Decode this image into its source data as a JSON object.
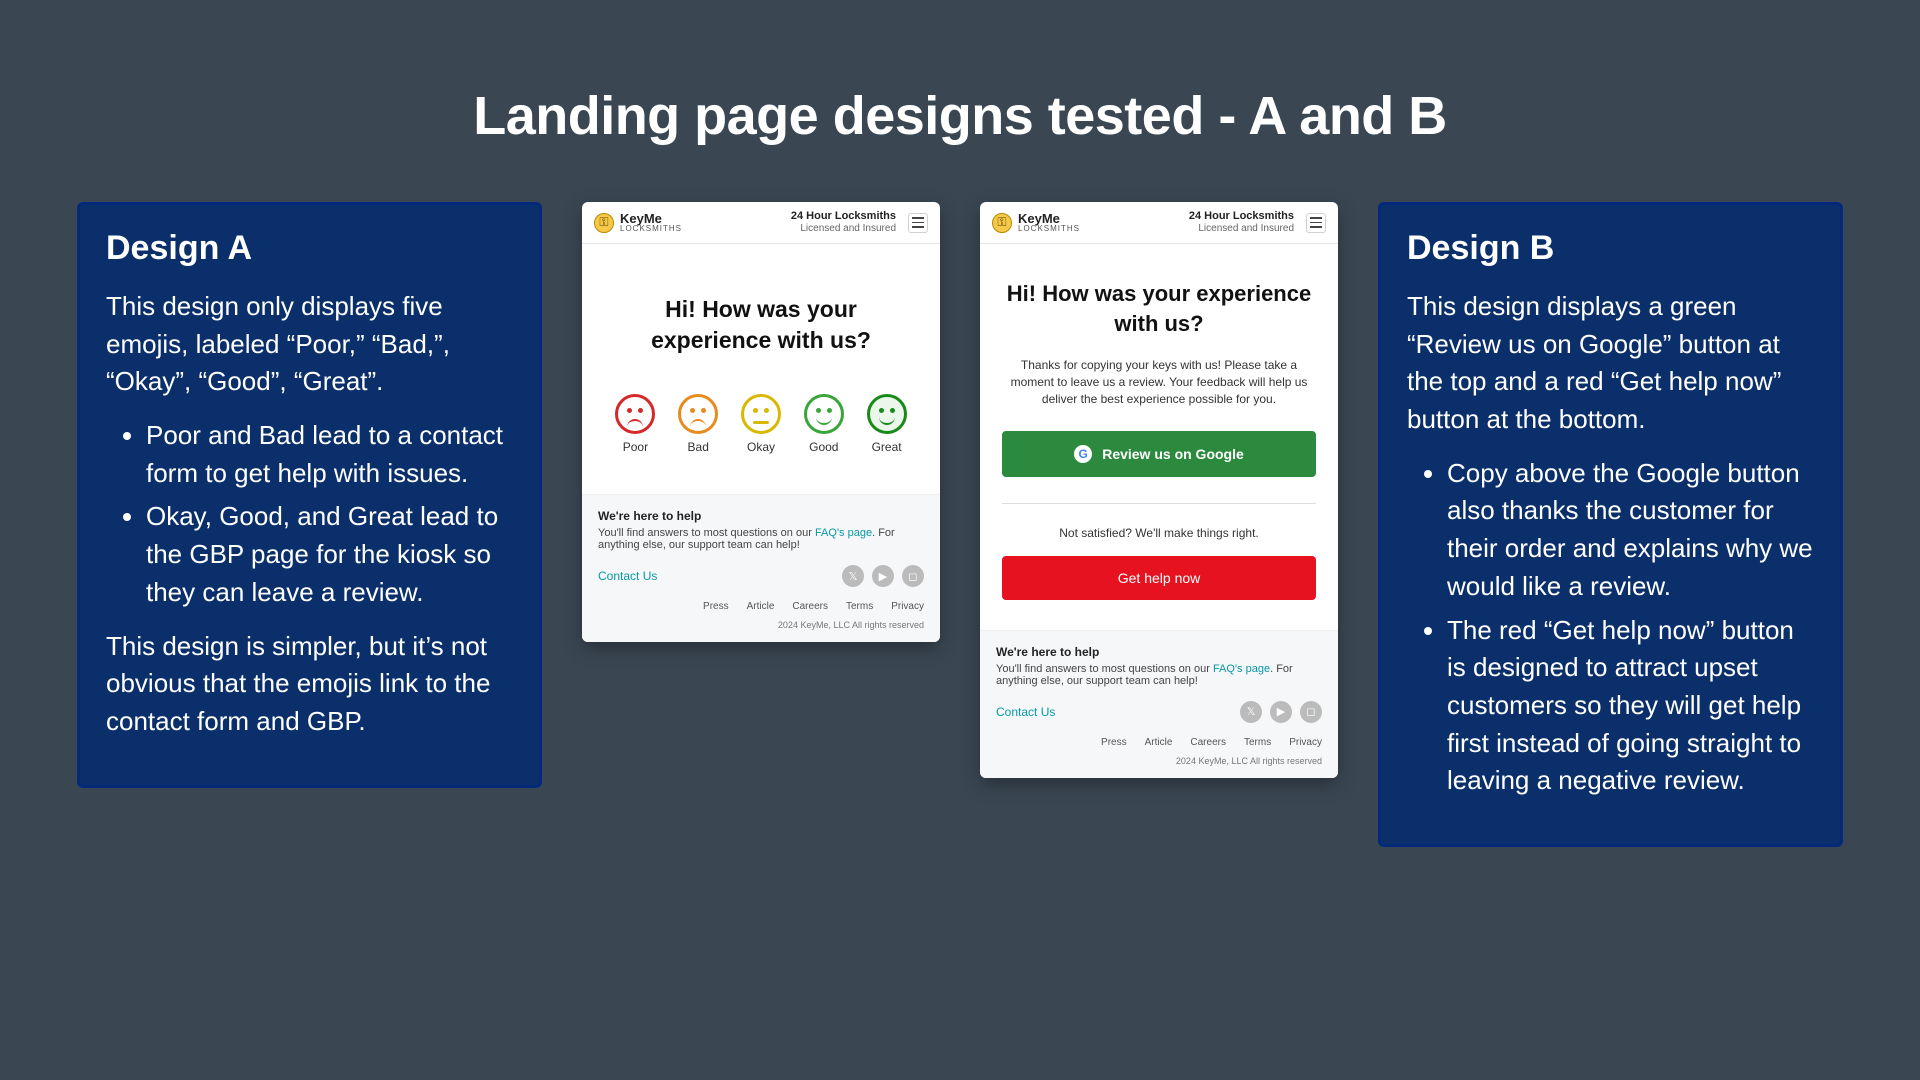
{
  "title": "Landing page designs tested - A and B",
  "designA": {
    "heading": "Design A",
    "intro": "This design only displays five emojis, labeled “Poor,” “Bad,”, “Okay”, “Good”, “Great”.",
    "bullets": [
      "Poor and Bad lead to a contact form to get help with issues.",
      "Okay, Good, and Great lead to the GBP page for the kiosk so they can leave a review."
    ],
    "outro": "This design is simpler, but it’s not obvious that the emojis link to the contact form and GBP."
  },
  "designB": {
    "heading": "Design B",
    "intro": "This design displays a green “Review us on Google” button at the top and a red “Get help now” button at the bottom.",
    "bullets": [
      "Copy above the Google button also thanks the customer for their order and explains why we would like a review.",
      "The red “Get help now” button is designed to attract upset customers so they will get help first instead of going straight to leaving a negative review."
    ]
  },
  "phoneCommon": {
    "brand": "KeyMe",
    "brandSub": "LOCKSMITHS",
    "header1": "24 Hour Locksmiths",
    "header2": "Licensed and Insured",
    "footerH": "We're here to help",
    "footerBody1": "You'll find answers to most questions on our ",
    "footerFaq": "FAQ's page",
    "footerBody2": ". For anything else, our support team can help!",
    "contact": "Contact Us",
    "links": [
      "Press",
      "Article",
      "Careers",
      "Terms",
      "Privacy"
    ],
    "copyright": "2024 KeyMe, LLC All rights reserved"
  },
  "phoneA": {
    "heading": "Hi! How was your experience with us?",
    "ratings": [
      "Poor",
      "Bad",
      "Okay",
      "Good",
      "Great"
    ]
  },
  "phoneB": {
    "heading": "Hi! How was your experience with us?",
    "thanks": "Thanks for copying your keys with us! Please take a moment to leave us a review. Your feedback will help us deliver the best experience possible for you.",
    "reviewBtn": "Review us on Google",
    "notSat": "Not satisfied? We'll make things right.",
    "helpBtn": "Get help now"
  }
}
